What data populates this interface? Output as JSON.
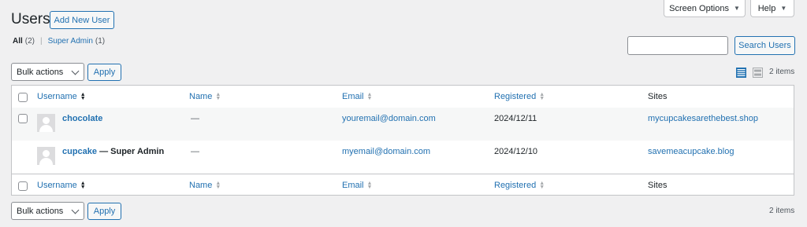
{
  "page": {
    "title": "Users",
    "add_new_label": "Add New User"
  },
  "top_tabs": {
    "screen_options": "Screen Options",
    "help": "Help"
  },
  "filters": {
    "all_label": "All",
    "all_count": "(2)",
    "separator": "|",
    "super_admin_label": "Super Admin",
    "super_admin_count": "(1)"
  },
  "search": {
    "value": "",
    "placeholder": "",
    "button_label": "Search Users"
  },
  "bulk": {
    "selected": "Bulk actions",
    "apply_label": "Apply"
  },
  "items_count": "2 items",
  "columns": {
    "username": "Username",
    "name": "Name",
    "email": "Email",
    "registered": "Registered",
    "sites": "Sites"
  },
  "rows": [
    {
      "username": "chocolate",
      "role_suffix": "",
      "name": "—",
      "email": "youremail@domain.com",
      "registered": "2024/12/11",
      "site": "mycupcakesarethebest.shop"
    },
    {
      "username": "cupcake",
      "role_suffix": " — Super Admin",
      "name": "—",
      "email": "myemail@domain.com",
      "registered": "2024/12/10",
      "site": "savemeacupcake.blog"
    }
  ],
  "icons": {
    "view_list": "list-view-icon",
    "view_excerpt": "excerpt-view-icon"
  },
  "colors": {
    "accent": "#2271b1",
    "background": "#f0f0f1",
    "border": "#c3c4c7"
  }
}
